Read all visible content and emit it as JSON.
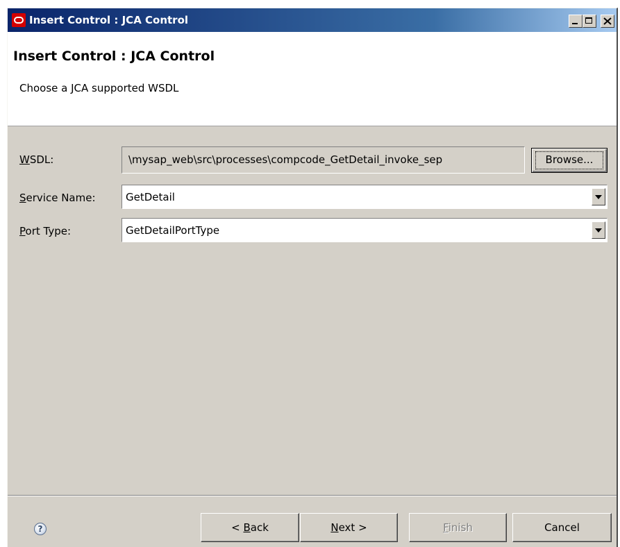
{
  "window": {
    "title": "Insert Control : JCA Control"
  },
  "header": {
    "title": "Insert Control : JCA Control",
    "description": "Choose a JCA supported WSDL"
  },
  "form": {
    "wsdl_label_mnemonic": "W",
    "wsdl_label_rest": "SDL:",
    "wsdl_value": "\\mysap_web\\src\\processes\\compcode_GetDetail_invoke_sep",
    "browse_label": "Browse...",
    "service_label_mnemonic": "S",
    "service_label_rest": "ervice Name:",
    "service_value": "GetDetail",
    "port_label_mnemonic": "P",
    "port_label_rest": "ort Type:",
    "port_value": "GetDetailPortType"
  },
  "footer": {
    "help_glyph": "?",
    "back_pre": "< ",
    "back_mnemonic": "B",
    "back_rest": "ack",
    "next_mnemonic": "N",
    "next_rest": "ext >",
    "finish_mnemonic": "F",
    "finish_rest": "inish",
    "cancel_label": "Cancel"
  },
  "icons": {
    "app": "oracle-logo-icon",
    "help": "help-icon"
  },
  "colors": {
    "titlebar_start": "#0a246a",
    "titlebar_end": "#a6caf0",
    "dialog_bg": "#d4d0c8",
    "header_bg": "#ffffff",
    "logo_red": "#d40000"
  }
}
